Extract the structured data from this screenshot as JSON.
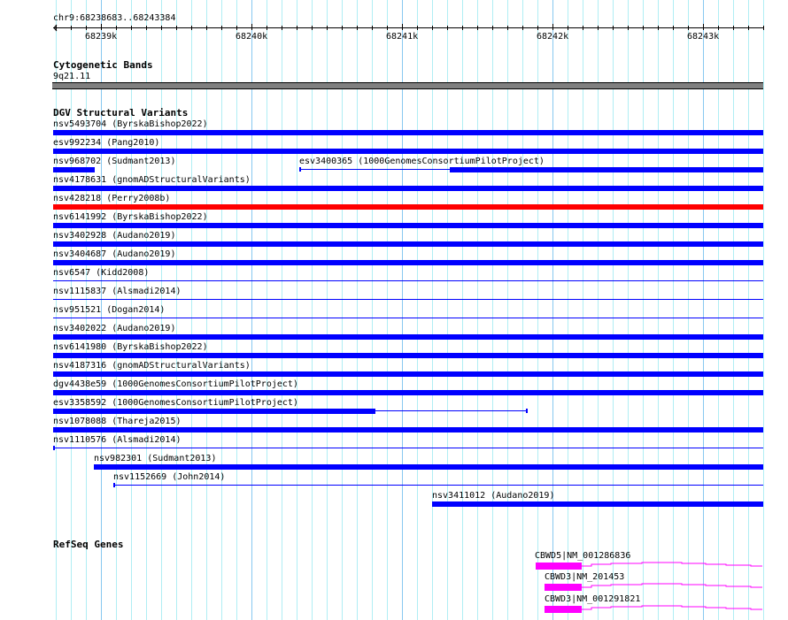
{
  "ruler": {
    "location": "chr9:68238683..68243384",
    "ticks": [
      "68239k",
      "68240k",
      "68241k",
      "68242k",
      "68243k"
    ]
  },
  "cytoband": {
    "title": "Cytogenetic Bands",
    "band": "9q21.11",
    "color": "#808080"
  },
  "dgv": {
    "title": "DGV Structural Variants",
    "colors": {
      "default": "#0000ff",
      "highlight": "#ff0000"
    },
    "variants": [
      {
        "label": "nsv5493704 (ByrskaBishop2022)"
      },
      {
        "label": "esv992234 (Pang2010)"
      },
      {
        "label": "nsv968702 (Sudmant2013)"
      },
      {
        "label": "esv3400365 (1000GenomesConsortiumPilotProject)"
      },
      {
        "label": "nsv4178631 (gnomADStructuralVariants)"
      },
      {
        "label": "nsv428218 (Perry2008b)"
      },
      {
        "label": "nsv6141992 (ByrskaBishop2022)"
      },
      {
        "label": "nsv3402928 (Audano2019)"
      },
      {
        "label": "nsv3404687 (Audano2019)"
      },
      {
        "label": "nsv6547 (Kidd2008)"
      },
      {
        "label": "nsv1115837 (Alsmadi2014)"
      },
      {
        "label": "nsv951521 (Dogan2014)"
      },
      {
        "label": "nsv3402022 (Audano2019)"
      },
      {
        "label": "nsv6141980 (ByrskaBishop2022)"
      },
      {
        "label": "nsv4187316 (gnomADStructuralVariants)"
      },
      {
        "label": "dgv4438e59 (1000GenomesConsortiumPilotProject)"
      },
      {
        "label": "esv3358592 (1000GenomesConsortiumPilotProject)"
      },
      {
        "label": "nsv1078088 (Thareja2015)"
      },
      {
        "label": "nsv1110576 (Alsmadi2014)"
      },
      {
        "label": "nsv982301 (Sudmant2013)"
      },
      {
        "label": "nsv1152669 (John2014)"
      },
      {
        "label": "nsv3411012 (Audano2019)"
      }
    ]
  },
  "refseq": {
    "title": "RefSeq Genes",
    "color": "#ff00ff",
    "genes": [
      {
        "label": "CBWD5|NM_001286836"
      },
      {
        "label": "CBWD3|NM_201453"
      },
      {
        "label": "CBWD3|NM_001291821"
      }
    ]
  }
}
